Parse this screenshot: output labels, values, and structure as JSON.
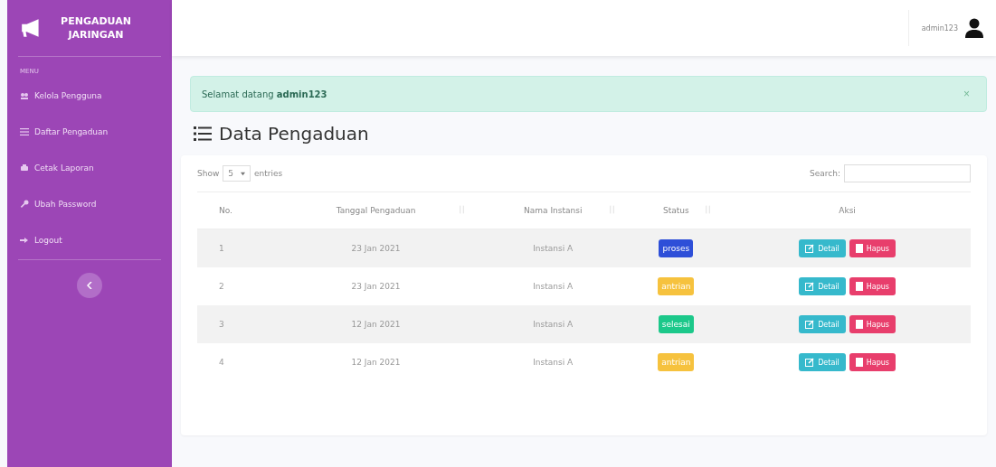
{
  "sidebar": {
    "brand": "PENGADUAN JARINGAN",
    "heading": "MENU",
    "items": [
      {
        "label": "Kelola Pengguna",
        "kind": "users"
      },
      {
        "label": "Daftar Pengaduan",
        "kind": "list"
      },
      {
        "label": "Cetak Laporan",
        "kind": "print"
      },
      {
        "label": "Ubah Password",
        "kind": "key"
      },
      {
        "label": "Logout",
        "kind": "logout"
      }
    ]
  },
  "topbar": {
    "user": "admin123"
  },
  "alert": {
    "text": "Selamat datang **admin123**",
    "close": "×"
  },
  "page_title": "Data Pengaduan",
  "table": {
    "show_label": "Show",
    "entries_value": "5",
    "entries_label": "entries",
    "search_label": "Search:",
    "columns": [
      {
        "label": "No.",
        "sortable": false
      },
      {
        "label": "Tanggal Pengaduan",
        "sortable": true
      },
      {
        "label": "Nama Instansi",
        "sortable": true
      },
      {
        "label": "Status",
        "sortable": true
      },
      {
        "label": "Aksi",
        "sortable": false
      }
    ],
    "rows": [
      {
        "no": "1",
        "date": "23 Jan 2021",
        "instansi": "Instansi A",
        "status": "proses",
        "color": "#2e4fd8",
        "detail": "Detail",
        "delete": "Hapus"
      },
      {
        "no": "2",
        "date": "23 Jan 2021",
        "instansi": "Instansi A",
        "status": "antrian",
        "color": "#f6c23e",
        "detail": "Detail",
        "delete": "Hapus"
      },
      {
        "no": "3",
        "date": "12 Jan 2021",
        "instansi": "Instansi A",
        "status": "selesai",
        "color": "#1cc88a",
        "detail": "Detail",
        "delete": "Hapus"
      },
      {
        "no": "4",
        "date": "12 Jan 2021",
        "instansi": "Instansi A",
        "status": "antrian",
        "color": "#f6c23e",
        "detail": "Detail",
        "delete": "Hapus"
      }
    ]
  }
}
